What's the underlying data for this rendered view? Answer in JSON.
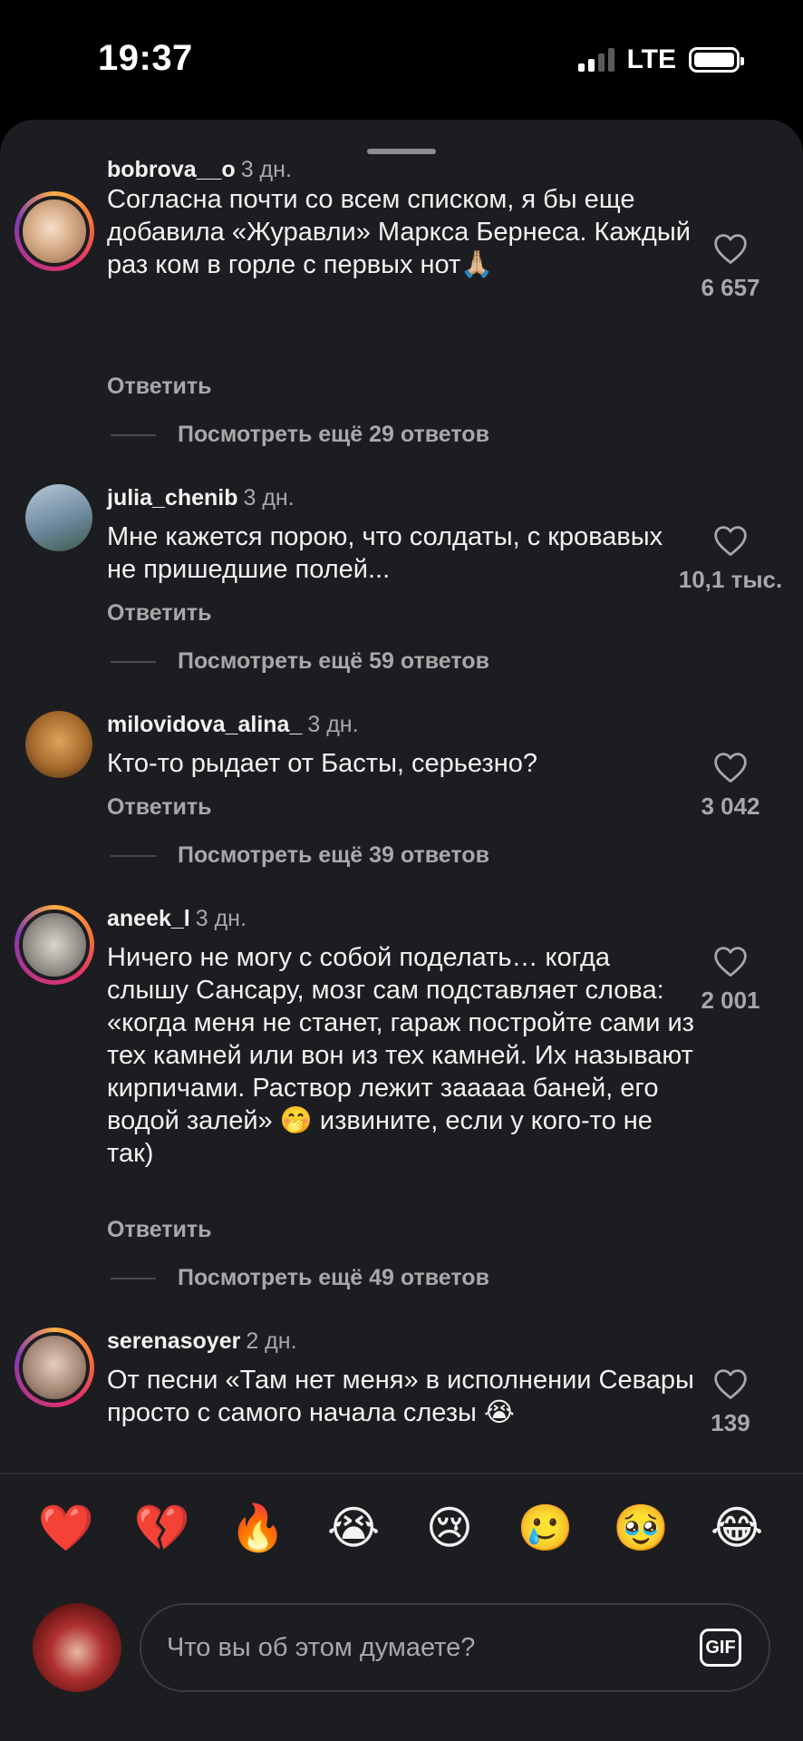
{
  "status": {
    "time": "19:37",
    "network": "LTE"
  },
  "comments": [
    {
      "username": "bobrova__o",
      "time": "3 дн.",
      "text": "Согласна почти со всем списком, я бы еще добавила «Журавли» Маркса Бернеса. Каждый раз ком в горле с первых нот🙏🏼",
      "reply": "Ответить",
      "likes": "6 657",
      "more_replies": "Посмотреть ещё 29 ответов"
    },
    {
      "username": "julia_chenib",
      "time": "3 дн.",
      "text": "Мне кажется порою, что солдаты, с кровавых не пришедшие полей...",
      "reply": "Ответить",
      "likes": "10,1 тыс.",
      "more_replies": "Посмотреть ещё 59 ответов"
    },
    {
      "username": "milovidova_alina_",
      "time": "3 дн.",
      "text": "Кто-то рыдает от Басты, серьезно?",
      "reply": "Ответить",
      "likes": "3 042",
      "more_replies": "Посмотреть ещё 39 ответов"
    },
    {
      "username": "aneek_l",
      "time": "3 дн.",
      "text": "Ничего не могу с собой поделать… когда слышу Сансару, мозг сам подставляет слова: «когда меня не станет, гараж постройте сами из тех камней или вон из тех камней. Их называют кирпичами. Раствор лежит зааааа баней, его водой залей» 🤭 извините, если у кого-то не так)",
      "reply": "Ответить",
      "likes": "2 001",
      "more_replies": "Посмотреть ещё 49 ответов"
    },
    {
      "username": "serenasoyer",
      "time": "2 дн.",
      "text": "От песни «Там нет меня» в исполнении Севары просто с самого начала слезы 😭",
      "likes": "139"
    }
  ],
  "reactions": [
    "❤️",
    "💔",
    "🔥",
    "😭",
    "😢",
    "🥲",
    "🥹",
    "😂"
  ],
  "composer": {
    "placeholder": "Что вы об этом думаете?",
    "gif_label": "GIF"
  }
}
